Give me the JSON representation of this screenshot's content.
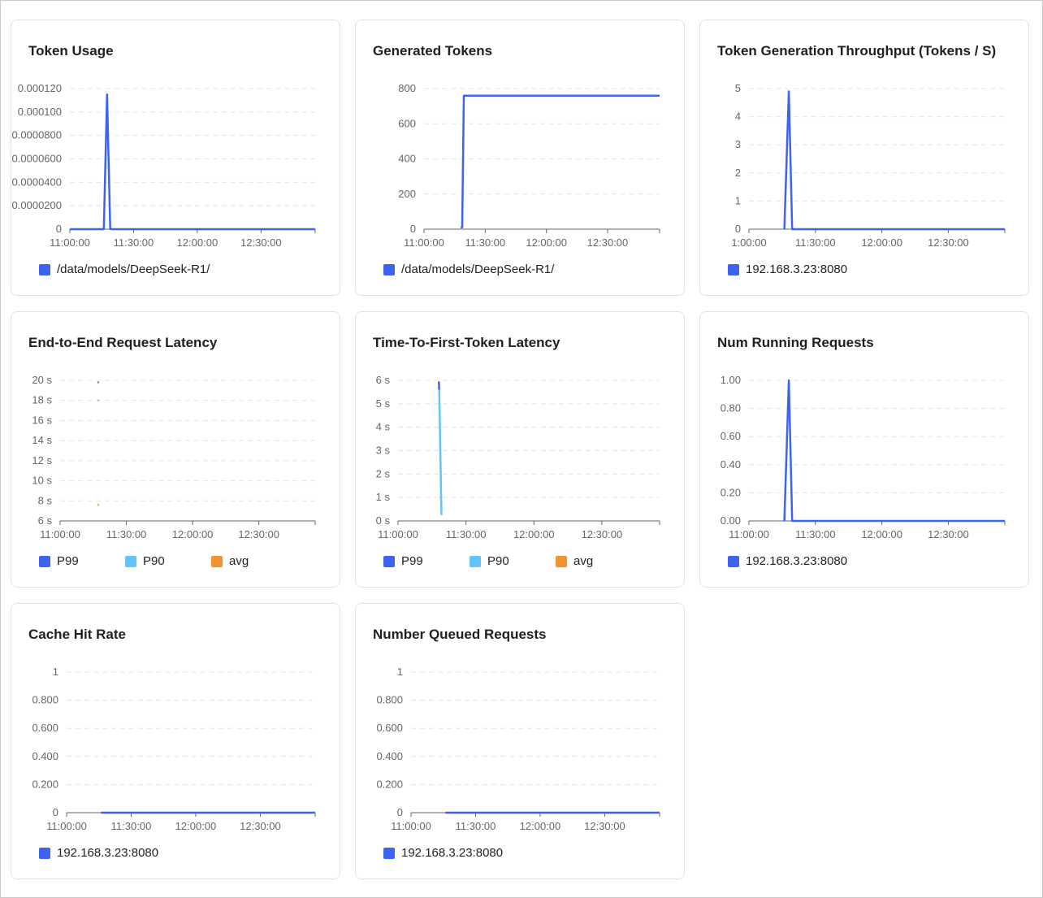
{
  "colors": {
    "p99": "#3d63f0",
    "p90": "#63c4fa",
    "avg": "#f0952e",
    "grid": "#e2e4e8",
    "axis": "#666666"
  },
  "charts": [
    {
      "id": "token-usage",
      "title": "Token Usage",
      "chart_data": {
        "type": "line",
        "title": "Token Usage",
        "y_ticks": [
          "0",
          "0.0000200",
          "0.0000400",
          "0.0000600",
          "0.0000800",
          "0.000100",
          "0.000120"
        ],
        "x_ticks": [
          "11:00:00",
          "11:30:00",
          "12:00:00",
          "12:30:00"
        ],
        "xlim_min": [
          0,
          120
        ],
        "ylim": [
          0,
          0.00012
        ],
        "series": [
          {
            "name": "/data/models/DeepSeek-R1/",
            "color": "#3d63f0",
            "points": [
              [
                0,
                0
              ],
              [
                16,
                0
              ],
              [
                17.5,
                0.000115
              ],
              [
                19,
                0
              ],
              [
                120,
                0
              ]
            ],
            "start": 16
          }
        ]
      },
      "legend": [
        {
          "label": "/data/models/DeepSeek-R1/",
          "color": "#3d63f0"
        }
      ]
    },
    {
      "id": "generated-tokens",
      "title": "Generated Tokens",
      "chart_data": {
        "type": "line",
        "title": "Generated Tokens",
        "y_ticks": [
          "0",
          "200",
          "400",
          "600",
          "800"
        ],
        "x_ticks": [
          "11:00:00",
          "11:30:00",
          "12:00:00",
          "12:30:00"
        ],
        "xlim_min": [
          0,
          120
        ],
        "ylim": [
          0,
          800
        ],
        "series": [
          {
            "name": "/data/models/DeepSeek-R1/",
            "color": "#3d63f0",
            "points": [
              [
                18,
                10
              ],
              [
                18.7,
                10
              ],
              [
                19.5,
                760
              ],
              [
                120,
                760
              ]
            ],
            "start": 18
          }
        ]
      },
      "legend": [
        {
          "label": "/data/models/DeepSeek-R1/",
          "color": "#3d63f0"
        }
      ]
    },
    {
      "id": "token-throughput",
      "title": "Token Generation Throughput (Tokens / S)",
      "chart_data": {
        "type": "line",
        "title": "Token Generation Throughput (Tokens / S)",
        "y_ticks": [
          "0",
          "1",
          "2",
          "3",
          "4",
          "5"
        ],
        "x_ticks": [
          "1:00:00",
          "11:30:00",
          "12:00:00",
          "12:30:00"
        ],
        "xlim_min": [
          0,
          120
        ],
        "ylim": [
          0,
          5
        ],
        "series": [
          {
            "name": "192.168.3.23:8080",
            "color": "#3d63f0",
            "points": [
              [
                16,
                0
              ],
              [
                18,
                4.9
              ],
              [
                19.5,
                0
              ],
              [
                120,
                0
              ]
            ],
            "start": 16
          }
        ]
      },
      "legend": [
        {
          "label": "192.168.3.23:8080",
          "color": "#3d63f0"
        }
      ]
    },
    {
      "id": "e2e-latency",
      "title": "End-to-End Request Latency",
      "chart_data": {
        "type": "line",
        "title": "End-to-End Request Latency",
        "y_ticks": [
          "6 s",
          "8 s",
          "10 s",
          "12 s",
          "14 s",
          "16 s",
          "18 s",
          "20 s"
        ],
        "x_ticks": [
          "11:00:00",
          "11:30:00",
          "12:00:00",
          "12:30:00"
        ],
        "xlim_min": [
          0,
          120
        ],
        "ylim": [
          6,
          20
        ],
        "series": [
          {
            "name": "P99",
            "color": "#3d63f0",
            "points": [
              [
                17,
                19.8
              ],
              [
                17.6,
                19.8
              ]
            ]
          },
          {
            "name": "P90",
            "color": "#63c4fa",
            "points": [
              [
                17,
                18.0
              ],
              [
                17.6,
                18.0
              ]
            ]
          },
          {
            "name": "avg",
            "color": "#f0952e",
            "points": [
              [
                17,
                7.6
              ],
              [
                17.6,
                7.6
              ]
            ]
          }
        ]
      },
      "legend": [
        {
          "label": "P99",
          "color": "#3d63f0"
        },
        {
          "label": "P90",
          "color": "#63c4fa"
        },
        {
          "label": "avg",
          "color": "#f0952e"
        }
      ]
    },
    {
      "id": "ttft-latency",
      "title": "Time-To-First-Token Latency",
      "chart_data": {
        "type": "line",
        "title": "Time-To-First-Token Latency",
        "y_ticks": [
          "0 s",
          "1 s",
          "2 s",
          "3 s",
          "4 s",
          "5 s",
          "6 s"
        ],
        "x_ticks": [
          "11:00:00",
          "11:30:00",
          "12:00:00",
          "12:30:00"
        ],
        "xlim_min": [
          0,
          120
        ],
        "ylim": [
          0,
          6
        ],
        "series": [
          {
            "name": "P99",
            "color": "#3d63f0",
            "points": [
              [
                18,
                5.95
              ],
              [
                18.2,
                5.6
              ]
            ]
          },
          {
            "name": "P90",
            "color": "#63c4fa",
            "points": [
              [
                18.2,
                5.6
              ],
              [
                19.2,
                0.25
              ]
            ]
          },
          {
            "name": "avg",
            "color": "#f0952e",
            "points": [
              [
                18.4,
                1.0
              ],
              [
                18.9,
                1.0
              ]
            ]
          }
        ]
      },
      "legend": [
        {
          "label": "P99",
          "color": "#3d63f0"
        },
        {
          "label": "P90",
          "color": "#63c4fa"
        },
        {
          "label": "avg",
          "color": "#f0952e"
        }
      ]
    },
    {
      "id": "num-running",
      "title": "Num Running Requests",
      "chart_data": {
        "type": "line",
        "title": "Num Running Requests",
        "y_ticks": [
          "0.00",
          "0.20",
          "0.40",
          "0.60",
          "0.80",
          "1.00"
        ],
        "x_ticks": [
          "11:00:00",
          "11:30:00",
          "12:00:00",
          "12:30:00"
        ],
        "xlim_min": [
          0,
          120
        ],
        "ylim": [
          0,
          1
        ],
        "series": [
          {
            "name": "192.168.3.23:8080",
            "color": "#3d63f0",
            "points": [
              [
                16,
                0
              ],
              [
                18,
                1.0
              ],
              [
                19.5,
                0
              ],
              [
                120,
                0
              ]
            ],
            "start": 16
          }
        ]
      },
      "legend": [
        {
          "label": "192.168.3.23:8080",
          "color": "#3d63f0"
        }
      ]
    },
    {
      "id": "cache-hit",
      "title": "Cache Hit Rate",
      "chart_data": {
        "type": "line",
        "title": "Cache Hit Rate",
        "y_ticks": [
          "0",
          "0.200",
          "0.400",
          "0.600",
          "0.800",
          "1"
        ],
        "x_ticks": [
          "11:00:00",
          "11:30:00",
          "12:00:00",
          "12:30:00"
        ],
        "xlim_min": [
          0,
          120
        ],
        "ylim": [
          0,
          1
        ],
        "series": [
          {
            "name": "192.168.3.23:8080",
            "color": "#3d63f0",
            "points": [
              [
                16,
                0
              ],
              [
                120,
                0
              ]
            ],
            "start": 16
          }
        ]
      },
      "legend": [
        {
          "label": "192.168.3.23:8080",
          "color": "#3d63f0"
        }
      ]
    },
    {
      "id": "queued",
      "title": "Number Queued Requests",
      "chart_data": {
        "type": "line",
        "title": "Number Queued Requests",
        "y_ticks": [
          "0",
          "0.200",
          "0.400",
          "0.600",
          "0.800",
          "1"
        ],
        "x_ticks": [
          "11:00:00",
          "11:30:00",
          "12:00:00",
          "12:30:00"
        ],
        "xlim_min": [
          0,
          120
        ],
        "ylim": [
          0,
          1
        ],
        "series": [
          {
            "name": "192.168.3.23:8080",
            "color": "#3d63f0",
            "points": [
              [
                16,
                0
              ],
              [
                120,
                0
              ]
            ],
            "start": 16
          }
        ]
      },
      "legend": [
        {
          "label": "192.168.3.23:8080",
          "color": "#3d63f0"
        }
      ]
    }
  ]
}
